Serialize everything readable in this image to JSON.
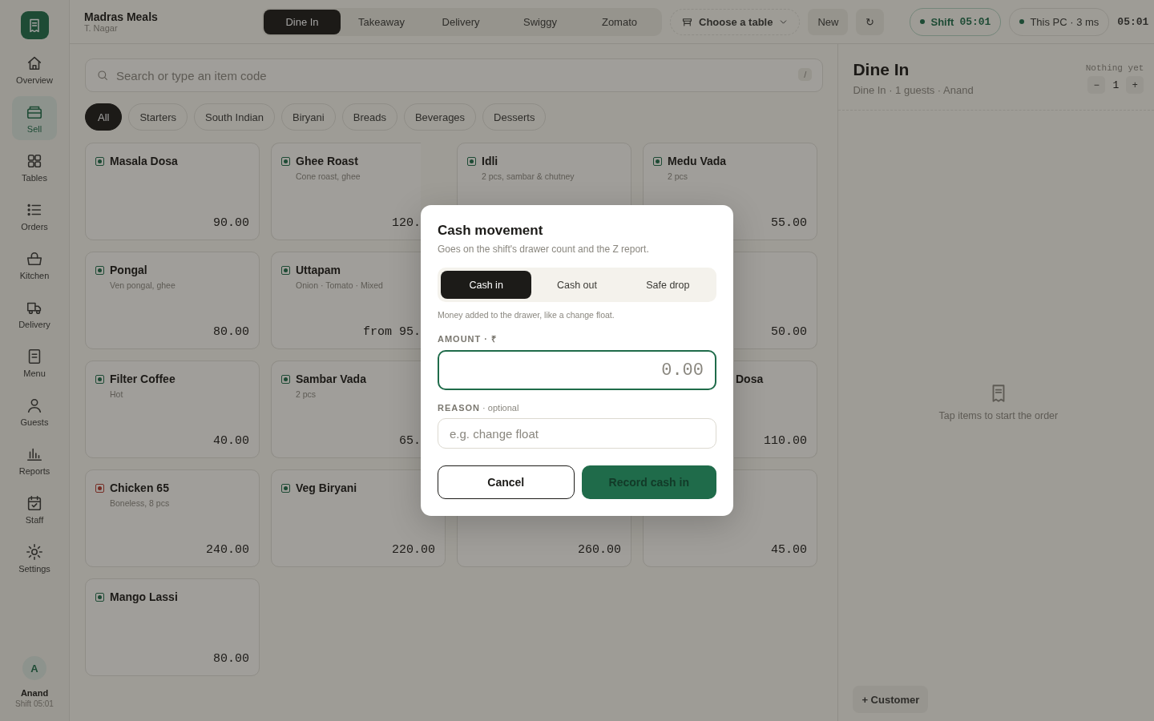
{
  "brand": {
    "name": "Madras Meals",
    "location": "T. Nagar"
  },
  "order_types": [
    {
      "label": "Dine In",
      "selected": true
    },
    {
      "label": "Takeaway",
      "selected": false
    },
    {
      "label": "Delivery",
      "selected": false
    },
    {
      "label": "Swiggy",
      "selected": false
    },
    {
      "label": "Zomato",
      "selected": false
    }
  ],
  "table_picker": {
    "label": "Choose a table"
  },
  "new_button": "New",
  "refresh_button": "↻",
  "shift_status": {
    "label": "Shift",
    "time": "05:01",
    "color": "#1e4b35"
  },
  "connection_status": {
    "label": "This PC · 3 ms",
    "color": "#1e4b35"
  },
  "clock": "05:01",
  "sidebar": {
    "items": [
      {
        "label": "Overview",
        "selected": false
      },
      {
        "label": "Sell",
        "selected": true
      },
      {
        "label": "Tables",
        "selected": false
      },
      {
        "label": "Orders",
        "selected": false
      },
      {
        "label": "Kitchen",
        "selected": false
      },
      {
        "label": "Delivery",
        "selected": false
      },
      {
        "label": "Menu",
        "selected": false
      },
      {
        "label": "Guests",
        "selected": false
      },
      {
        "label": "Reports",
        "selected": false
      },
      {
        "label": "Staff",
        "selected": false
      },
      {
        "label": "Settings",
        "selected": false
      }
    ],
    "user": {
      "initial": "A",
      "name": "Anand",
      "shift": "Shift 05:01"
    }
  },
  "search": {
    "placeholder": "Search or type an item code",
    "shortcut": "/"
  },
  "categories": [
    {
      "label": "All",
      "selected": true
    },
    {
      "label": "Starters",
      "selected": false
    },
    {
      "label": "South Indian",
      "selected": false
    },
    {
      "label": "Biryani",
      "selected": false
    },
    {
      "label": "Breads",
      "selected": false
    },
    {
      "label": "Beverages",
      "selected": false
    },
    {
      "label": "Desserts",
      "selected": false
    }
  ],
  "items": [
    {
      "kind": "card",
      "name": "Masala Dosa",
      "price": "90.00",
      "color": "#1e4b35"
    },
    {
      "kind": "clipped_right",
      "name": "Ghee Roast",
      "description": "Cone roast, ghee",
      "price": "120.",
      "color": "#1e4b35"
    },
    {
      "kind": "card",
      "name": "Idli",
      "description": "2 pcs, sambar & chutney",
      "color": "#1e4b35"
    },
    {
      "kind": "card",
      "name": "Medu Vada",
      "description": "2 pcs",
      "price": "55.00",
      "color": "#1e4b35"
    },
    {
      "kind": "card",
      "name": "Pongal",
      "description": "Ven pongal, ghee",
      "price": "80.00",
      "color": "#1e4b35"
    },
    {
      "kind": "clipped_right",
      "name": "Uttapam",
      "description": "Onion · Tomato · Mixed",
      "price": "from 95.",
      "color": "#1e4b35"
    },
    {
      "kind": "clipped_left",
      "price": "50.00"
    },
    {
      "kind": "card",
      "name": "Filter Coffee",
      "description": "Hot",
      "price": "40.00",
      "color": "#1e4b35"
    },
    {
      "kind": "clipped_right",
      "name": "Sambar Vada",
      "description": "2 pcs",
      "price": "65.",
      "color": "#1e4b35"
    },
    {
      "kind": "clipped_left",
      "name": "Dosa",
      "price": "110.00"
    },
    {
      "kind": "card",
      "name": "Chicken 65",
      "description": "Boneless, 8 pcs",
      "price": "240.00",
      "color": "#772d25"
    },
    {
      "kind": "card",
      "name": "Veg Biryani",
      "price": "220.00",
      "color": "#1e4b35"
    },
    {
      "kind": "card",
      "price": "260.00"
    },
    {
      "kind": "card",
      "price": "45.00"
    },
    {
      "kind": "card",
      "name": "Mango Lassi",
      "price": "80.00",
      "color": "#1e4b35"
    }
  ],
  "order": {
    "title": "Dine In",
    "meta": "Dine In · 1 guests · Anand",
    "status": "Nothing yet",
    "guest_decrement": "−",
    "guests": "1",
    "guest_increment": "+",
    "empty_message": "Tap items to start the order",
    "customer_button": "+ Customer"
  },
  "modal": {
    "title": "Cash movement",
    "subtitle": "Goes on the shift's drawer count and the Z report.",
    "modes": [
      {
        "label": "Cash in",
        "selected": true
      },
      {
        "label": "Cash out",
        "selected": false
      },
      {
        "label": "Safe drop",
        "selected": false
      }
    ],
    "hint": "Money added to the drawer, like a change float.",
    "amount_label": "AMOUNT · ₹",
    "amount_placeholder": "0.00",
    "reason_label": "**REASON** · optional",
    "reason_placeholder": "e.g. change float",
    "cancel": "Cancel",
    "confirm": "Record cash in"
  }
}
